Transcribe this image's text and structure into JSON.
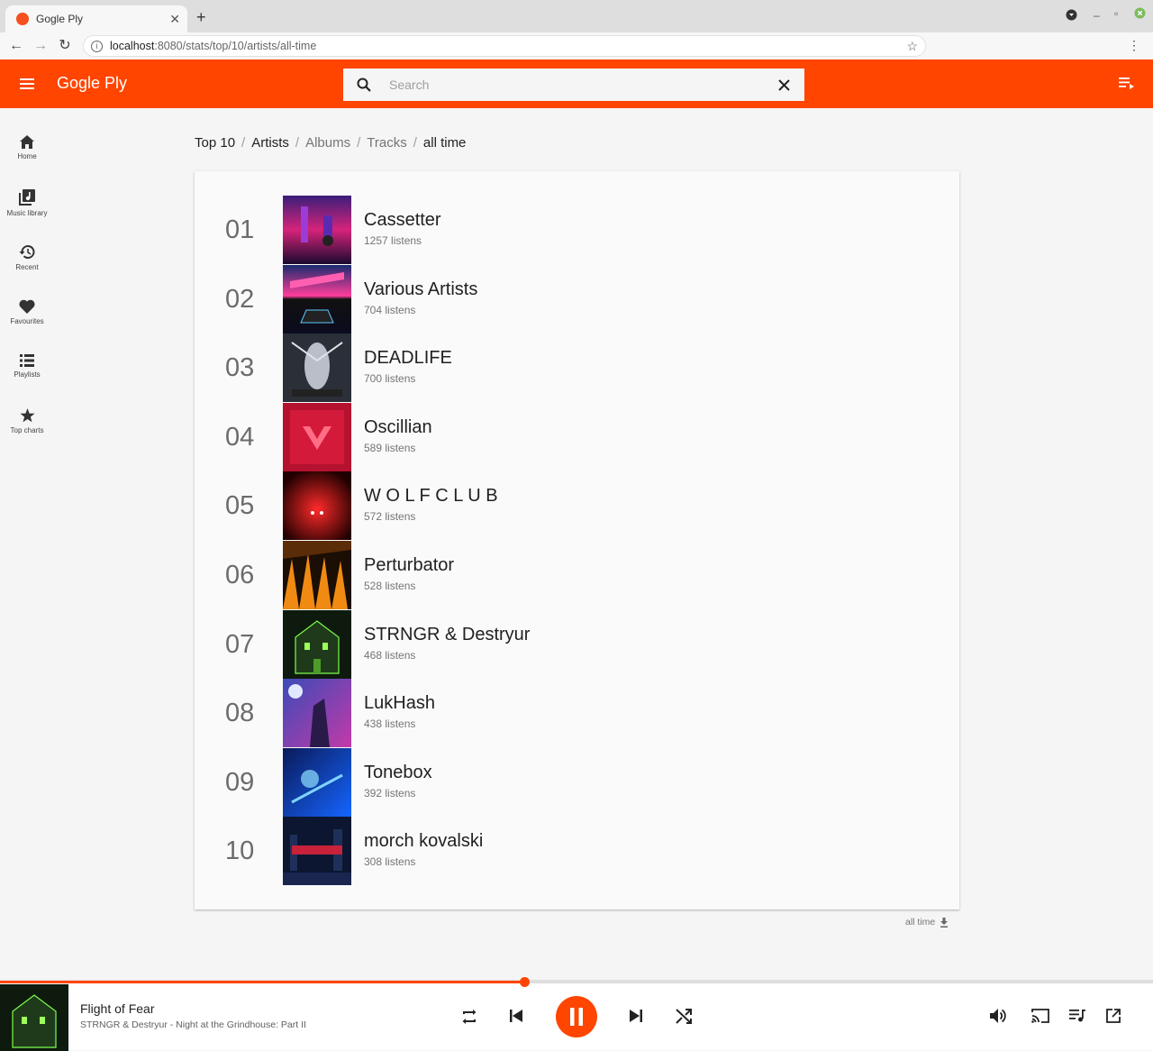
{
  "browser": {
    "tab_title": "Gogle Ply",
    "url_host": "localhost",
    "url_path": ":8080/stats/top/10/artists/all-time"
  },
  "header": {
    "title": "Gogle Ply",
    "search_placeholder": "Search"
  },
  "sidebar": {
    "items": [
      {
        "label": "Home",
        "icon": "home-icon"
      },
      {
        "label": "Music library",
        "icon": "library-icon"
      },
      {
        "label": "Recent",
        "icon": "history-icon"
      },
      {
        "label": "Favourites",
        "icon": "heart-icon"
      },
      {
        "label": "Playlists",
        "icon": "list-icon"
      },
      {
        "label": "Top charts",
        "icon": "star-icon"
      }
    ]
  },
  "breadcrumb": {
    "top": "Top 10",
    "artists": "Artists",
    "albums": "Albums",
    "tracks": "Tracks",
    "period": "all time"
  },
  "chart": {
    "rows": [
      {
        "rank": "01",
        "artist": "Cassetter",
        "listens": "1257 listens"
      },
      {
        "rank": "02",
        "artist": "Various Artists",
        "listens": "704 listens"
      },
      {
        "rank": "03",
        "artist": "DEADLIFE",
        "listens": "700 listens"
      },
      {
        "rank": "04",
        "artist": "Oscillian",
        "listens": "589 listens"
      },
      {
        "rank": "05",
        "artist": "W O L F C L U B",
        "listens": "572 listens"
      },
      {
        "rank": "06",
        "artist": "Perturbator",
        "listens": "528 listens"
      },
      {
        "rank": "07",
        "artist": "STRNGR & Destryur",
        "listens": "468 listens"
      },
      {
        "rank": "08",
        "artist": "LukHash",
        "listens": "438 listens"
      },
      {
        "rank": "09",
        "artist": "Tonebox",
        "listens": "392 listens"
      },
      {
        "rank": "10",
        "artist": "morch kovalski",
        "listens": "308 listens"
      }
    ],
    "footer_label": "all time"
  },
  "player": {
    "title": "Flight of Fear",
    "subtitle": "STRNGR & Destryur - Night at the Grindhouse: Part II",
    "progress": 0.455
  },
  "colors": {
    "accent": "#ff4500"
  }
}
